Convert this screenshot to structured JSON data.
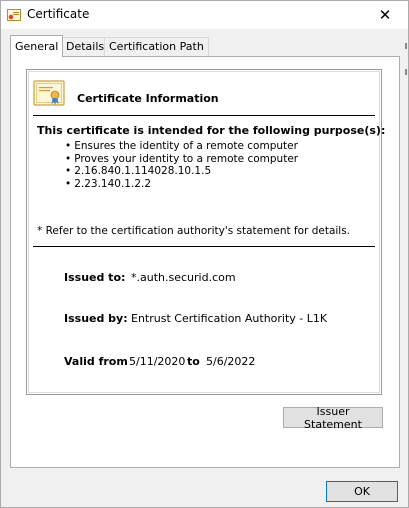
{
  "window": {
    "title": "Certificate",
    "close_glyph": "✕"
  },
  "tabs": [
    {
      "label": "General",
      "active": true
    },
    {
      "label": "Details",
      "active": false
    },
    {
      "label": "Certification Path",
      "active": false
    }
  ],
  "info": {
    "title": "Certificate Information",
    "purpose_heading": "This certificate is intended for the following purpose(s):",
    "purposes": [
      "Ensures the identity of a remote computer",
      "Proves your identity to a remote computer",
      "2.16.840.1.114028.10.1.5",
      "2.23.140.1.2.2"
    ],
    "footnote": "* Refer to the certification authority's statement for details.",
    "issued_to_label": "Issued to:",
    "issued_to_value": "*.auth.securid.com",
    "issued_by_label": "Issued by:",
    "issued_by_value": "Entrust Certification Authority - L1K",
    "valid_from_label": "Valid from",
    "valid_from_value": "5/11/2020",
    "valid_to_label": "to",
    "valid_to_value": "5/6/2022"
  },
  "buttons": {
    "issuer_statement": "Issuer Statement",
    "ok": "OK"
  },
  "colors": {
    "accent": "#0078d7",
    "certificate_icon": "#e8b84a"
  }
}
